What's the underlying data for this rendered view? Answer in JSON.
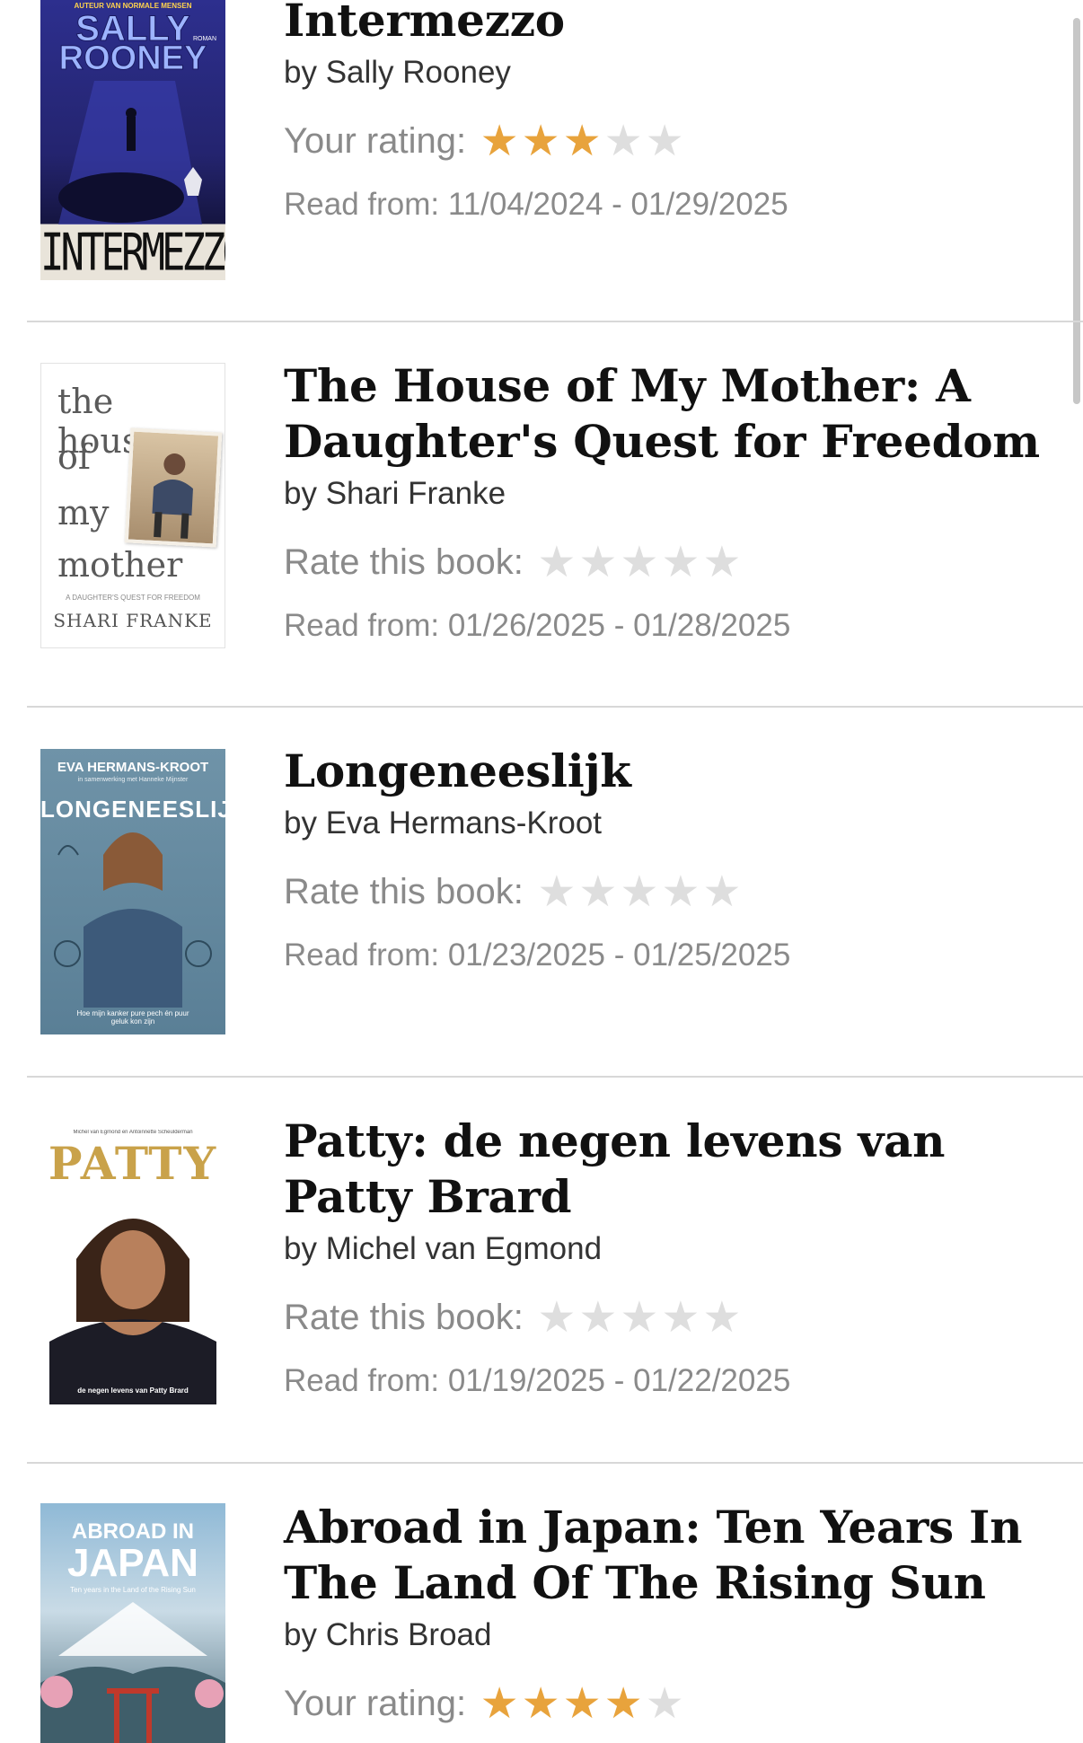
{
  "books": [
    {
      "title": "Intermezzo",
      "author": "by Sally Rooney",
      "rating_label": "Your rating:",
      "rating": 3,
      "read": "Read from: 11/04/2024 - 01/29/2025",
      "cover": {
        "top": "AUTEUR VAN NORMALE MENSEN",
        "author_line1": "SALLY",
        "author_line2": "ROONEY",
        "tag": "ROMAN",
        "title": "INTERMEZZO"
      }
    },
    {
      "title": "The House of My Mother: A Daughter's Quest for Freedom",
      "author": "by Shari Franke",
      "rating_label": "Rate this book:",
      "rating": 0,
      "read": "Read from: 01/26/2025 - 01/28/2025",
      "cover": {
        "w1": "the house",
        "w2": "of",
        "w3": "my",
        "w4": "mother",
        "sub": "A DAUGHTER'S QUEST FOR FREEDOM",
        "author": "SHARI FRANKE"
      }
    },
    {
      "title": "Longeneeslijk",
      "author": "by Eva Hermans-Kroot",
      "rating_label": "Rate this book:",
      "rating": 0,
      "read": "Read from: 01/23/2025 - 01/25/2025",
      "cover": {
        "author": "EVA HERMANS-KROOT",
        "with": "in samenwerking met Hanneke Mijnster",
        "title": "LONGENEESLIJK",
        "tagline": "Hoe mijn kanker pure pech én puur geluk kon zijn"
      }
    },
    {
      "title": "Patty: de negen levens van Patty Brard",
      "author": "by Michel van Egmond",
      "rating_label": "Rate this book:",
      "rating": 0,
      "read": "Read from: 01/19/2025 - 01/22/2025",
      "cover": {
        "authors": "Michel van Egmond en Antoinnette Scheulderman",
        "title": "PATTY",
        "sub": "de negen levens van Patty Brard"
      }
    },
    {
      "title": "Abroad in Japan: Ten Years In The Land Of The Rising Sun",
      "author": "by Chris Broad",
      "rating_label": "Your rating:",
      "rating": 4,
      "read": "",
      "cover": {
        "line1": "ABROAD IN",
        "line2": "JAPAN",
        "sub": "Ten years in the Land of the Rising Sun"
      }
    }
  ],
  "colors": {
    "star_on": "#e8a33c",
    "star_off": "#dedede",
    "muted_text": "#8a8a8a"
  }
}
